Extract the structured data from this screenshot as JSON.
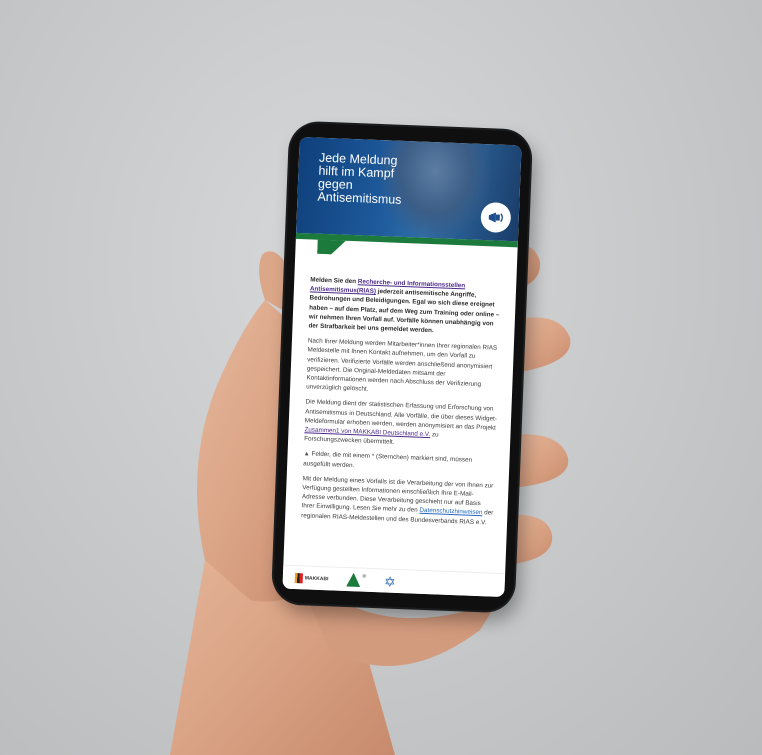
{
  "hero": {
    "title": "Jede Meldung\nhilft im Kampf\ngegen\nAntisemitismus",
    "badge_icon": "megaphone-icon"
  },
  "intro": {
    "text_before_link": "Melden Sie den ",
    "link_text": "Recherche- und Informationsstellen Antisemitismus(RIAS)",
    "text_after_link": " jederzeit antisemitische Angriffe, Bedrohungen und Beleidigungen. Egal wo sich diese ereignet haben – auf dem Platz, auf dem Weg zum Training oder online – wir nehmen Ihren Vorfall auf. Vorfälle können unabhängig von der Strafbarkeit bei uns gemeldet werden."
  },
  "paragraph2": "Nach Ihrer Meldung werden Mitarbeiter*innen Ihrer regionalen RIAS Meldestelle mit Ihnen Kontakt aufnehmen, um den Vorfall zu verifizieren. Verifizierte Vorfälle werden anschließend anonymisiert gespeichert. Die Original-Meldedaten mitsamt der Kontaktinformationen werden nach Abschluss der Verifizierung unverzüglich gelöscht.",
  "paragraph3": {
    "text_before_link": "Die Meldung dient der statistischen Erfassung und Erforschung von Antisemitismus in Deutschland. Alle Vorfälle, die über dieses Widget-Meldeformular erhoben werden, werden anonymisiert an das Projekt ",
    "link_text": "Zusammen1 von MAKKABI Deutschland e.V.",
    "text_after_link": " zu Forschungszwecken übermittelt."
  },
  "paragraph4": {
    "icon": "warning-icon",
    "text": "Felder, die mit einem * (Sternchen) markiert sind, müssen ausgefüllt werden."
  },
  "paragraph5": {
    "text_before_link": "Mit der Meldung eines Vorfalls ist die Verarbeitung der von Ihnen zur Verfügung gestellten Informationen einschließlich Ihre E-Mail-Adresse verbunden. Diese Verarbeitung geschieht nur auf Basis Ihrer Einwilligung. Lesen Sie mehr zu den ",
    "link_text": "Datenschutzhinweisen",
    "text_after_link": " der regionalen RIAS-Meldestellen und des Bundesverbands RIAS e.V."
  },
  "footer": {
    "logo1_text": "MAKKABI",
    "logo2_mark": "®",
    "logo3_icon": "star-of-david-icon"
  },
  "colors": {
    "hero_blue": "#1e5a9c",
    "accent_green": "#1c7a3c",
    "link_purple": "#4b2a8a",
    "link_blue": "#2468c0",
    "background": "#c9cbcc"
  }
}
